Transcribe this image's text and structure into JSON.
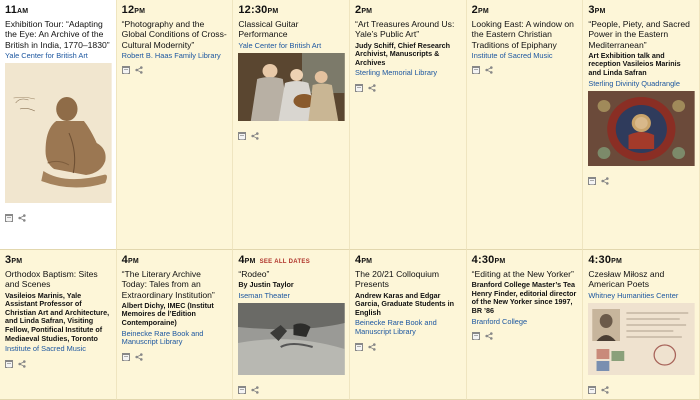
{
  "events": [
    {
      "time": "11",
      "ampm": "AM",
      "title": "Exhibition Tour: “Adapting the Eye: An Archive of the British in India, 1770–1830”",
      "desc": "",
      "venue": "Yale Center for British Art",
      "image": "seated-figure-sketch",
      "see_all": ""
    },
    {
      "time": "12",
      "ampm": "PM",
      "title": "“Photography and the Global Conditions of Cross-Cultural Modernity”",
      "desc": "",
      "venue": "Robert B. Haas Family Library",
      "image": "",
      "see_all": ""
    },
    {
      "time": "12:30",
      "ampm": "PM",
      "title": "Classical Guitar Performance",
      "desc": "",
      "venue": "Yale Center for British Art",
      "image": "musicians-painting",
      "see_all": ""
    },
    {
      "time": "2",
      "ampm": "PM",
      "title": "“Art Treasures Around Us: Yale’s Public Art”",
      "desc": "Judy Schiff, Chief Research Archivist, Manuscripts & Archives",
      "venue": "Sterling Memorial Library",
      "image": "",
      "see_all": ""
    },
    {
      "time": "2",
      "ampm": "PM",
      "title": "Looking East: A window on the Eastern Christian Traditions of Epiphany",
      "desc": "",
      "venue": "Institute of Sacred Music",
      "image": "",
      "see_all": ""
    },
    {
      "time": "3",
      "ampm": "PM",
      "title": "“People, Piety, and Sacred Power in the Eastern Mediterranean”",
      "desc": "Art Exhibition talk and reception Vasileios Marinis and Linda Safran",
      "venue": "Sterling Divinity Quadrangle",
      "image": "fresco-icon",
      "see_all": ""
    },
    {
      "time": "3",
      "ampm": "PM",
      "title": "Orthodox Baptism: Sites and Scenes",
      "desc": "Vasileios Marinis, Yale Assistant Professor of Christian Art and Architecture, and Linda Safran, Visiting Fellow, Pontifical Institute of Mediaeval Studies, Toronto",
      "venue": "Institute of Sacred Music",
      "image": "",
      "see_all": ""
    },
    {
      "time": "4",
      "ampm": "PM",
      "title": "“The Literary Archive Today: Tales from an Extraordinary Institution”",
      "desc": "Albert Dichy, IMEC (Institut Memoires de l’Edition Contemporaine)",
      "venue": "Beinecke Rare Book and Manuscript Library",
      "image": "",
      "see_all": ""
    },
    {
      "time": "4",
      "ampm": "PM",
      "title": "“Rodeo”",
      "desc": "By Justin Taylor",
      "venue": "Iseman Theater",
      "image": "rodeo-photo",
      "see_all": "SEE ALL DATES"
    },
    {
      "time": "4",
      "ampm": "PM",
      "title": "The 20/21 Colloquium Presents",
      "desc": "Andrew Karas and Edgar Garcia, Graduate Students in English",
      "venue": "Beinecke Rare Book and Manuscript Library",
      "image": "",
      "see_all": ""
    },
    {
      "time": "4:30",
      "ampm": "PM",
      "title": "“Editing at the New Yorker”",
      "desc": "Branford College Master’s Tea Henry Finder, editorial director of the New Yorker since 1997, BR ’86",
      "venue": "Branford College",
      "image": "",
      "see_all": ""
    },
    {
      "time": "4:30",
      "ampm": "PM",
      "title": "Czesław Miłosz and American Poets",
      "desc": "",
      "venue": "Whitney Humanities Center",
      "image": "passport-document",
      "see_all": ""
    }
  ],
  "colors": {
    "background": "#fdf6d8",
    "highlight": "#ffffff",
    "link": "#1d57a0",
    "accent": "#b0332a"
  }
}
